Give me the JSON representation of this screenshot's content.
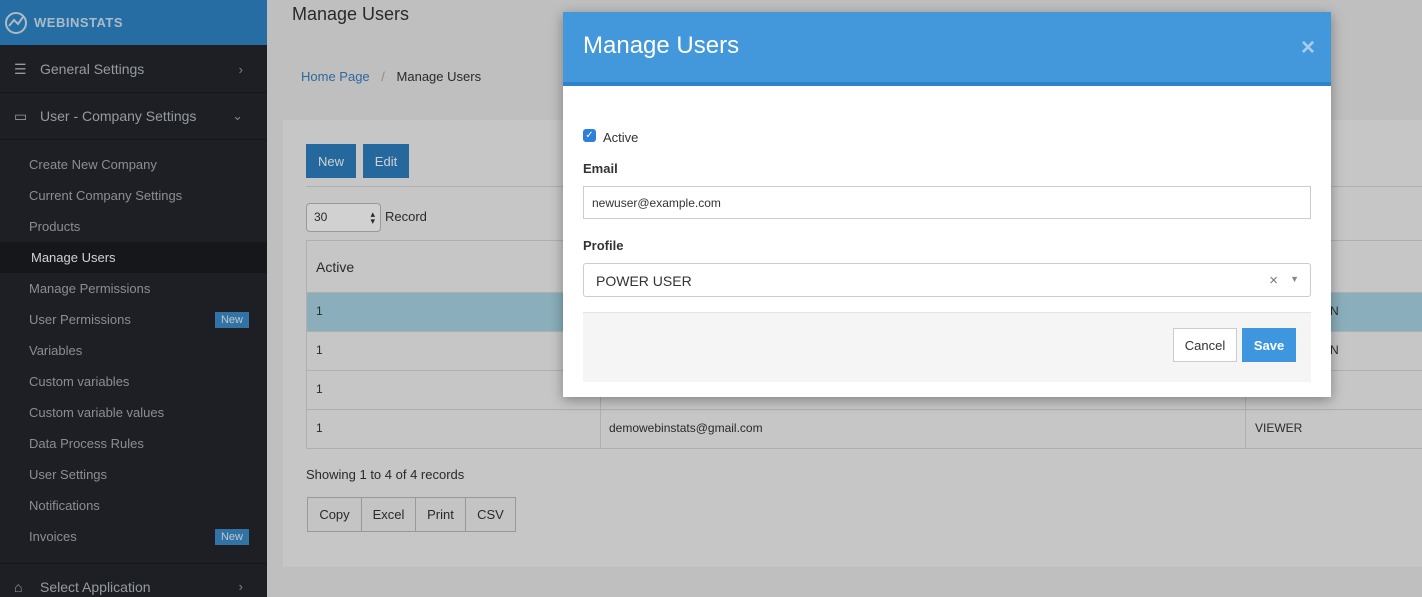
{
  "brand": {
    "name": "WEBINSTATS"
  },
  "sidebar": {
    "general": "General Settings",
    "user_company": "User - Company Settings",
    "items": [
      {
        "label": "Create New Company"
      },
      {
        "label": "Current Company Settings"
      },
      {
        "label": "Products"
      },
      {
        "label": "Manage Users"
      },
      {
        "label": "Manage Permissions"
      },
      {
        "label": "User Permissions",
        "badge": "New"
      },
      {
        "label": "Variables"
      },
      {
        "label": "Custom variables"
      },
      {
        "label": "Custom variable values"
      },
      {
        "label": "Data Process Rules"
      },
      {
        "label": "User Settings"
      },
      {
        "label": "Notifications"
      },
      {
        "label": "Invoices",
        "badge": "New"
      }
    ],
    "select_app": "Select Application"
  },
  "page": {
    "title": "Manage Users",
    "breadcrumb": {
      "home": "Home Page",
      "sep": "/",
      "current": "Manage Users"
    }
  },
  "toolbar": {
    "new_label": "New",
    "edit_label": "Edit"
  },
  "records": {
    "value": "30",
    "label": "Record"
  },
  "table": {
    "header_active": "Active",
    "rows": [
      {
        "active": "1",
        "email": "",
        "profile": "N"
      },
      {
        "active": "1",
        "email": "",
        "profile": "N"
      },
      {
        "active": "1",
        "email": "",
        "profile": ""
      },
      {
        "active": "1",
        "email": "demowebinstats@gmail.com",
        "profile": "VIEWER"
      }
    ]
  },
  "summary": "Showing 1 to 4 of 4 records",
  "export": {
    "copy": "Copy",
    "excel": "Excel",
    "print": "Print",
    "csv": "CSV"
  },
  "modal": {
    "title": "Manage Users",
    "close": "×",
    "active_label": "Active",
    "email_label": "Email",
    "email_value": "newuser@example.com",
    "profile_label": "Profile",
    "profile_value": "POWER USER",
    "profile_clear": "×",
    "cancel": "Cancel",
    "save": "Save"
  },
  "colors": {
    "brand": "#2e86c7",
    "sidebar": "#24272c",
    "modal_header": "#4298da",
    "primary_button": "#2c7fc0"
  }
}
